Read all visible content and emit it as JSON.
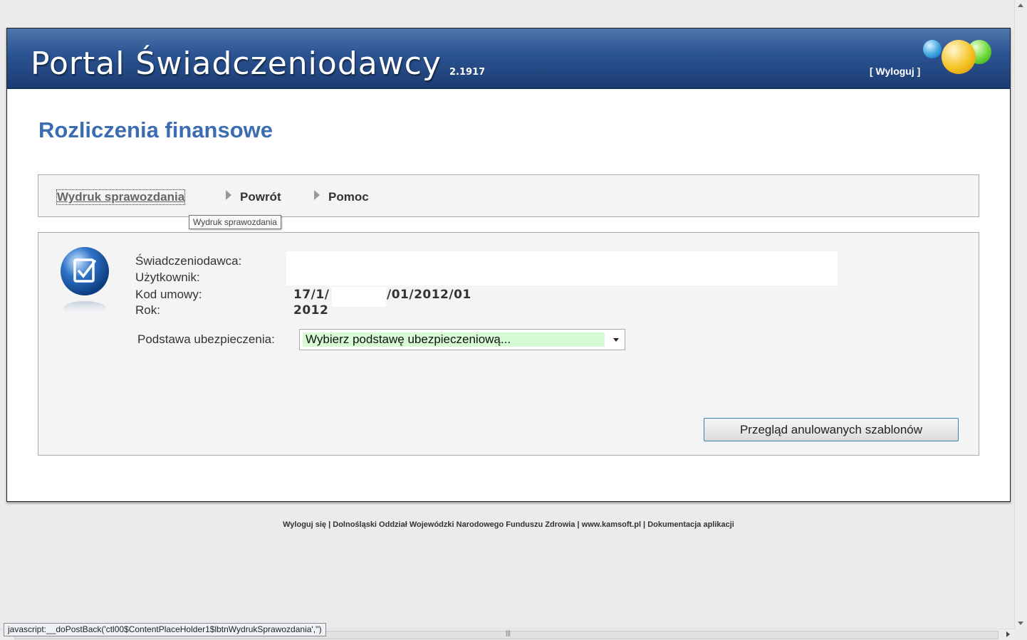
{
  "header": {
    "title": "Portal Świadczeniodawcy",
    "version": "2.1917",
    "logout_label": "[ Wyloguj ]"
  },
  "page": {
    "heading": "Rozliczenia finansowe"
  },
  "menu": {
    "items": [
      {
        "label": "Wydruk sprawozdania"
      },
      {
        "label": "Powrót"
      },
      {
        "label": "Pomoc"
      }
    ],
    "tooltip": "Wydruk sprawozdania"
  },
  "info": {
    "swiadczeniodawca_label": "Świadczeniodawca:",
    "uzytkownik_label": "Użytkownik:",
    "kod_umowy_label": "Kod umowy:",
    "kod_umowy_prefix": "17/1/",
    "kod_umowy_suffix": "/01/2012/01",
    "rok_label": "Rok:",
    "rok_value": "2012"
  },
  "form": {
    "podstawa_label": "Podstawa ubezpieczenia:",
    "podstawa_selected": "Wybierz podstawę ubezpieczeniową..."
  },
  "buttons": {
    "anulowane": "Przegląd anulowanych szablonów"
  },
  "footer": {
    "links": [
      "Wyloguj się",
      "Dolnośląski Oddział Wojewódzki Narodowego Funduszu Zdrowia",
      "www.kamsoft.pl",
      "Dokumentacja aplikacji"
    ],
    "separator": " | "
  },
  "status_bar": {
    "text": "javascript:__doPostBack('ctl00$ContentPlaceHolder1$lbtnWydrukSprawozdania','')"
  },
  "colors": {
    "header_blue": "#2b5391",
    "heading_blue": "#3b6db3",
    "select_bg": "#d6fbd4",
    "button_border": "#3c7fb1"
  },
  "icons": [
    "checklist-icon",
    "logo-balls-icon",
    "menu-arrow-icon",
    "dropdown-arrow-icon"
  ]
}
